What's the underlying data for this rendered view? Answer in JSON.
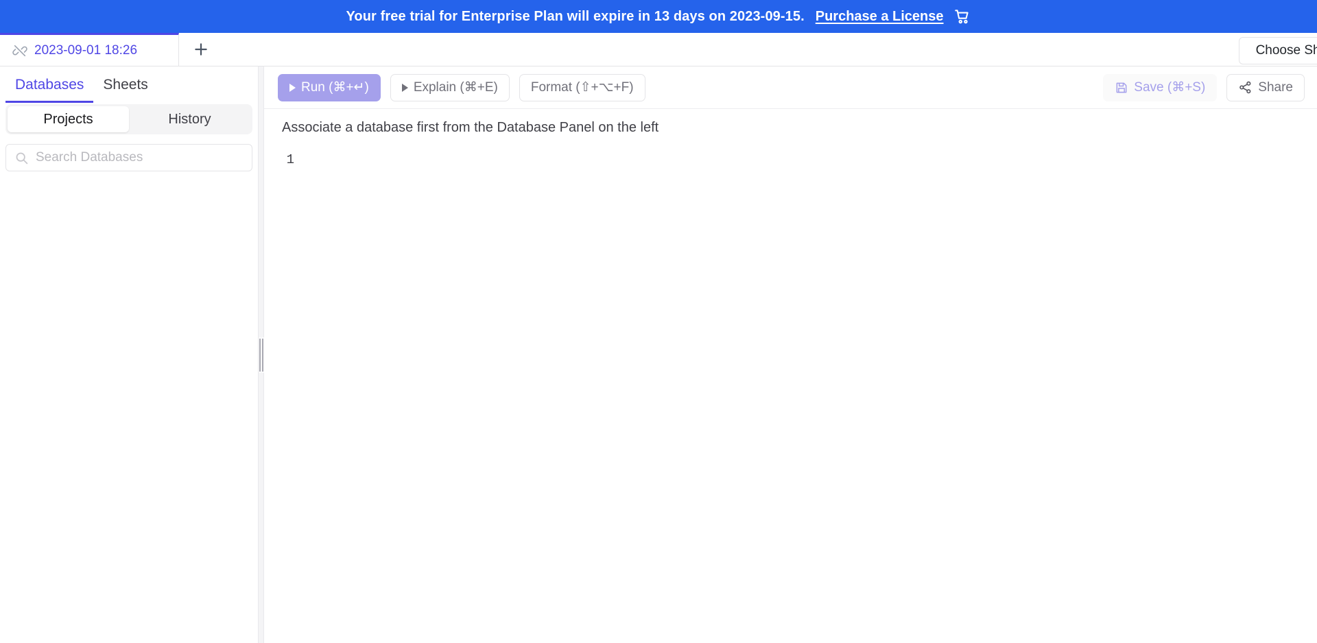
{
  "banner": {
    "message": "Your free trial for Enterprise Plan will expire in 13 days on 2023-09-15.",
    "link_label": "Purchase a License",
    "cart_icon": "shopping-cart-icon",
    "background_color": "#2563EB",
    "text_color": "#FFFFFF"
  },
  "tabstrip": {
    "tabs": [
      {
        "label": "2023-09-01 18:26",
        "icon": "disconnected-link-icon",
        "active": true,
        "accent_color": "#4F46E5"
      }
    ],
    "add_tab_label": "+",
    "choose_sheet_label": "Choose Sheet"
  },
  "sidebar": {
    "tabs": [
      {
        "label": "Databases",
        "active": true
      },
      {
        "label": "Sheets",
        "active": false
      }
    ],
    "segments": [
      {
        "label": "Projects",
        "active": true
      },
      {
        "label": "History",
        "active": false
      }
    ],
    "search": {
      "placeholder": "Search Databases",
      "value": "",
      "icon": "search-icon"
    },
    "items": []
  },
  "splitter": {
    "name": "panel-resize-handle"
  },
  "toolbar": {
    "run_label": "Run (⌘+↵)",
    "explain_label": "Explain (⌘+E)",
    "format_label": "Format (⇧+⌥+F)",
    "save_label": "Save (⌘+S)",
    "share_label": "Share",
    "run_color": "#A5A0EB",
    "save_color": "#A5A0EB"
  },
  "editor": {
    "notice": "Associate a database first from the Database Panel on the left",
    "lines": [
      {
        "number": "1",
        "text": ""
      }
    ]
  }
}
